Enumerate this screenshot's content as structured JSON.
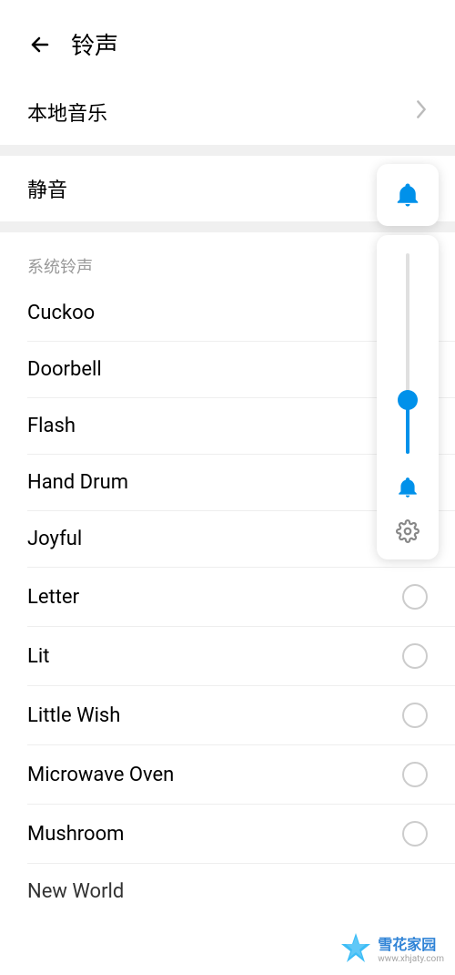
{
  "header": {
    "title": "铃声"
  },
  "local_music": {
    "label": "本地音乐"
  },
  "silent": {
    "label": "静音"
  },
  "section": {
    "system_ringtones": "系统铃声"
  },
  "ringtones": [
    {
      "label": "Cuckoo",
      "has_radio": false
    },
    {
      "label": "Doorbell",
      "has_radio": false
    },
    {
      "label": "Flash",
      "has_radio": false
    },
    {
      "label": "Hand Drum",
      "has_radio": false
    },
    {
      "label": "Joyful",
      "has_radio": false
    },
    {
      "label": "Letter",
      "has_radio": true
    },
    {
      "label": "Lit",
      "has_radio": true
    },
    {
      "label": "Little Wish",
      "has_radio": true
    },
    {
      "label": "Microwave Oven",
      "has_radio": true
    },
    {
      "label": "Mushroom",
      "has_radio": true
    }
  ],
  "cutoff_item": "New World",
  "volume": {
    "percent": 27
  },
  "colors": {
    "accent": "#0091ea"
  },
  "watermark": {
    "name": "雪花家园",
    "url": "www.xhjaty.com"
  }
}
